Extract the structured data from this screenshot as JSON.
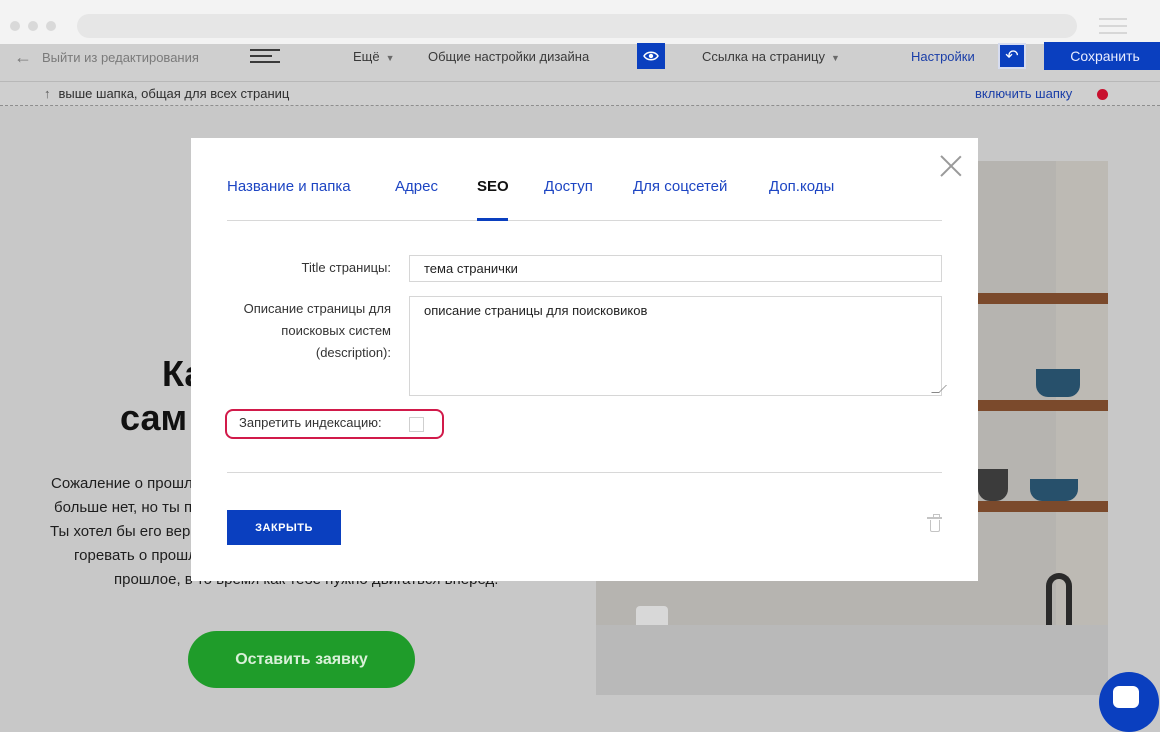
{
  "toolbar": {
    "exit_label": "Выйти из редактирования",
    "more_label": "Ещё",
    "design_settings": "Общие настройки дизайна",
    "page_link": "Ссылка на страницу",
    "settings": "Настройки",
    "save": "Сохранить"
  },
  "header_strip": {
    "label": "выше шапка, общая для всех страниц",
    "enable_header": "включить шапку"
  },
  "page": {
    "hero_title_line1": "Ка",
    "hero_title_line2": "сам",
    "hero_text": [
      "Сожаление о прошл",
      "больше нет, но ты по",
      "Ты хотел бы его верн",
      "горевать о прошл",
      "прошлое, в то время как тебе нужно двигаться вперед."
    ],
    "cta_label": "Оставить заявку"
  },
  "modal": {
    "tabs": [
      {
        "label": "Название и папка",
        "active": false
      },
      {
        "label": "Адрес",
        "active": false
      },
      {
        "label": "SEO",
        "active": true
      },
      {
        "label": "Доступ",
        "active": false
      },
      {
        "label": "Для соцсетей",
        "active": false
      },
      {
        "label": "Доп.коды",
        "active": false
      }
    ],
    "title_label": "Title страницы:",
    "title_value": "тема странички",
    "description_label_lines": [
      "Описание страницы для",
      "поисковых систем",
      "(description):"
    ],
    "description_value": "описание страницы для поисковиков",
    "noindex_label": "Запретить индексацию:",
    "noindex_checked": false,
    "close_button": "ЗАКРЫТЬ"
  },
  "colors": {
    "accent": "#0a3fbf",
    "highlight": "#d11a4a",
    "cta": "#1f9c2a"
  }
}
